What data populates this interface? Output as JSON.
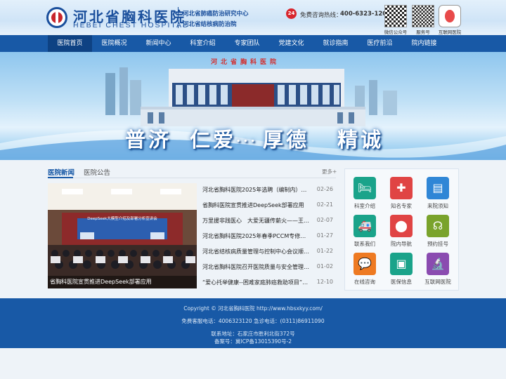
{
  "header": {
    "logo_cn": "河北省胸科医院",
    "logo_en": "HEBEI  CHEST HOSPITAL",
    "center1": "河北省肺癌防治研究中心",
    "center2": "河北省结核病防治院",
    "phone_icon": "24",
    "phone_label": "免费咨询热线：",
    "phone_number": "400-6323-120",
    "qr_codes": [
      {
        "label": "微信公众号",
        "icon": "qr-code-icon"
      },
      {
        "label": "服务号",
        "icon": "qr-code-icon"
      },
      {
        "label": "互联网医院",
        "icon": "internet-hospital-icon"
      }
    ]
  },
  "nav": {
    "items": [
      {
        "label": "医院首页",
        "active": true
      },
      {
        "label": "医院概况"
      },
      {
        "label": "新闻中心"
      },
      {
        "label": "科室介绍"
      },
      {
        "label": "专家团队"
      },
      {
        "label": "党建文化"
      },
      {
        "label": "就诊指南"
      },
      {
        "label": "医疗前沿"
      },
      {
        "label": "院内链接"
      }
    ]
  },
  "banner": {
    "sign": "河北省胸科医院",
    "slogan": [
      "普济",
      "仁爱",
      "厚德",
      "精诚"
    ],
    "slogan_sep": "..."
  },
  "news": {
    "tabs": [
      "医院新闻",
      "医院公告"
    ],
    "more": "更多+",
    "photo_caption": "省胸科医院宣贯推进DeepSeek部署应用",
    "photo_screen_text": "DeepSeek大模型介绍及部署分析宣讲会",
    "items": [
      {
        "title": "河北省胸科医院2025年选聘（编制内）工作人员",
        "date": "02-26"
      },
      {
        "title": "省胸科医院宣贯推进DeepSeek部署应用",
        "date": "02-21"
      },
      {
        "title": "万里援非践医心　大爱无疆传薪火——王磊医生",
        "date": "02-07"
      },
      {
        "title": "河北省胸科医院2025年春季PCCM专修、肺功能",
        "date": "01-27"
      },
      {
        "title": "河北省结核病质量管理与控制中心会议顺利召开",
        "date": "01-22"
      },
      {
        "title": "河北省胸科医院召开医院质量与安全管理委员会",
        "date": "01-02"
      },
      {
        "title": "“爱心托举健康--困难家庭肺癌救助项目”在我院",
        "date": "12-10"
      }
    ]
  },
  "services": [
    {
      "label": "科室介绍",
      "icon": "hospital-bed-icon",
      "color": "#1aa38a"
    },
    {
      "label": "知名专家",
      "icon": "nurse-icon",
      "color": "#e04444"
    },
    {
      "label": "来院须知",
      "icon": "document-icon",
      "color": "#2f86d6"
    },
    {
      "label": "联系我们",
      "icon": "ambulance-icon",
      "color": "#1aa38a"
    },
    {
      "label": "院内导航",
      "icon": "map-pin-icon",
      "color": "#e04444"
    },
    {
      "label": "预约挂号",
      "icon": "stethoscope-icon",
      "color": "#7aa32c"
    },
    {
      "label": "在线咨询",
      "icon": "chat-bubble-icon",
      "color": "#ee7a22"
    },
    {
      "label": "医保信息",
      "icon": "id-card-icon",
      "color": "#1aa38a"
    },
    {
      "label": "互联网医院",
      "icon": "microscope-icon",
      "color": "#8a4bb0"
    }
  ],
  "footer": {
    "copyright": "Copyright © 河北省胸科医院 http://www.hbsxkyy.com/",
    "phones": "免费客服电话：4006323120 急诊电话：(0311)86911090",
    "address": "联系地址：石家庄市胜利北街372号",
    "icp": "备案号：冀ICP备13015390号-2"
  }
}
